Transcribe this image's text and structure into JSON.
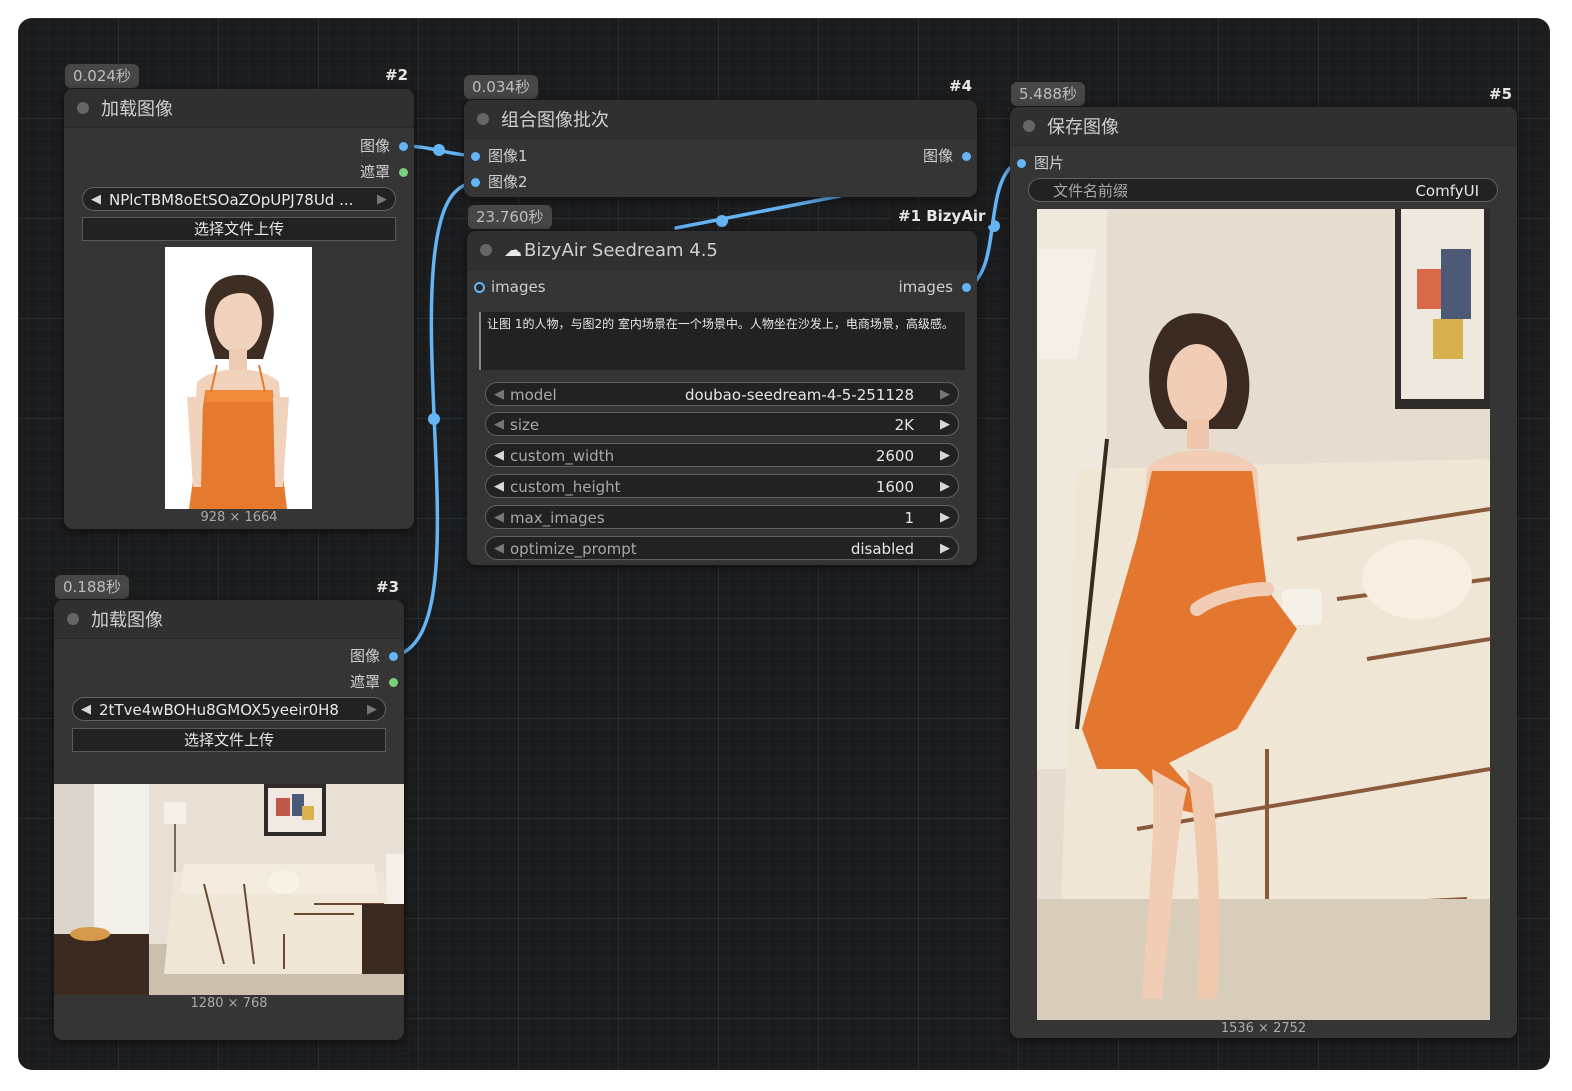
{
  "nodes": {
    "load1": {
      "time": "0.024秒",
      "id": "#2",
      "title": "加载图像",
      "out_image": "图像",
      "out_mask": "遮罩",
      "file": "NPlcTBM8oEtSOaZOpUPJ78Ud ...",
      "upload": "选择文件上传",
      "dims": "928 × 1664"
    },
    "load2": {
      "time": "0.188秒",
      "id": "#3",
      "title": "加载图像",
      "out_image": "图像",
      "out_mask": "遮罩",
      "file": "2tTve4wBOHu8GMOX5yeeir0H8 ...",
      "upload": "选择文件上传",
      "dims": "1280 × 768"
    },
    "batch": {
      "time": "0.034秒",
      "id": "#4",
      "title": "组合图像批次",
      "in1": "图像1",
      "in2": "图像2",
      "out": "图像"
    },
    "bizy": {
      "time": "23.760秒",
      "id": "#1 BizyAir",
      "title": "BizyAir Seedream 4.5",
      "in": "images",
      "out": "images",
      "prompt": "让图 1的人物，与图2的 室内场景在一个场景中。人物坐在沙发上，电商场景，高级感。",
      "widgets": [
        {
          "label": "model",
          "value": "doubao-seedream-4-5-251128"
        },
        {
          "label": "size",
          "value": "2K"
        },
        {
          "label": "custom_width",
          "value": "2600"
        },
        {
          "label": "custom_height",
          "value": "1600"
        },
        {
          "label": "max_images",
          "value": "1"
        },
        {
          "label": "optimize_prompt",
          "value": "disabled"
        }
      ]
    },
    "save": {
      "time": "5.488秒",
      "id": "#5",
      "title": "保存图像",
      "in": "图片",
      "prefix_label": "文件名前缀",
      "prefix_value": "ComfyUI",
      "dims": "1536 × 2752"
    }
  },
  "colors": {
    "canvas": "#1b1c1e",
    "node": "#353535",
    "node_header": "#303030",
    "link_image": "#64b5f6",
    "slot_mask": "#7bd17b"
  }
}
